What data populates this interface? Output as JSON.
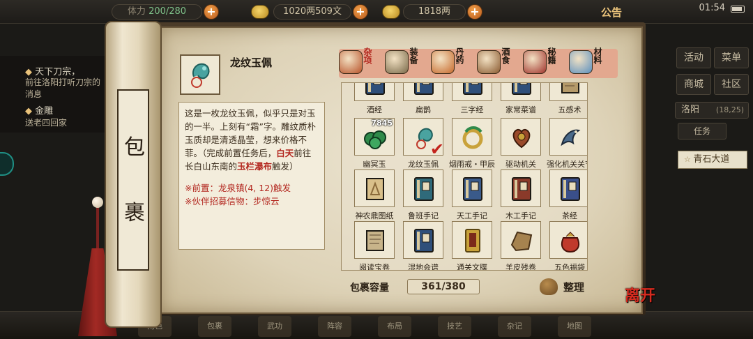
{
  "topbar": {
    "stamina_label": "体力",
    "stamina_value": "200/280",
    "money": "1020两509文",
    "ingot": "1818两",
    "notice": "公告",
    "clock": "01:54"
  },
  "quests": [
    {
      "title": "天下刀宗，",
      "desc": "前往洛阳打听刀宗的消息"
    },
    {
      "title": "金雕",
      "desc": "送老四回家"
    }
  ],
  "right_panel": {
    "buttons": [
      "活动",
      "菜单",
      "商城",
      "社区"
    ],
    "location": "洛阳",
    "coord": "(18,25)",
    "sub_tab": "任务",
    "place": "青石大道"
  },
  "scroll": {
    "title_chars": [
      "包",
      "裹"
    ]
  },
  "detail": {
    "name": "龙纹玉佩",
    "desc_parts": [
      {
        "text": "这是一枚龙纹玉佩，似乎只是对玉的一半。上刻有“霜”字。雕纹质朴玉质却是清透晶莹，想来价格不菲。（完成前置任务后，",
        "hl": false
      },
      {
        "text": "白天",
        "hl": true
      },
      {
        "text": "前往长白山东南的",
        "hl": false
      },
      {
        "text": "玉栏瀑布",
        "hl": true
      },
      {
        "text": "触发）",
        "hl": false
      }
    ],
    "requirements": [
      "※前置：龙泉镇(4, 12)触发",
      "※伙伴招募信物：步惊云"
    ]
  },
  "tabs": [
    {
      "label": "杂项",
      "active": true,
      "color": "#b8532a"
    },
    {
      "label": "装备",
      "active": false,
      "color": "#7a6a4a"
    },
    {
      "label": "丹药",
      "active": false,
      "color": "#c76a2c"
    },
    {
      "label": "酒食",
      "active": false,
      "color": "#8a5a30"
    },
    {
      "label": "秘籍",
      "active": false,
      "color": "#a0332c"
    },
    {
      "label": "材料",
      "active": false,
      "color": "#5a8fbf"
    }
  ],
  "grid_rows": [
    {
      "partial_top": true,
      "items": [
        {
          "name": "酒经",
          "icon": "book-icon",
          "color": "#2f4f7a"
        },
        {
          "name": "扁鹊",
          "icon": "book-icon",
          "color": "#2f4f7a"
        },
        {
          "name": "三字经",
          "icon": "book-icon",
          "color": "#2f4f7a"
        },
        {
          "name": "家常菜谱",
          "icon": "book-icon",
          "color": "#2f4f7a"
        },
        {
          "name": "五感术",
          "icon": "scroll-icon",
          "color": "#b59a6a"
        }
      ]
    },
    {
      "partial_top": false,
      "items": [
        {
          "name": "幽冥玉",
          "icon": "jade-icon",
          "color": "#2f8a4a",
          "count": "7845"
        },
        {
          "name": "龙纹玉佩",
          "icon": "pendant-icon",
          "color": "#4aa3a0",
          "checked": true
        },
        {
          "name": "烟雨戒・甲辰",
          "icon": "ring-icon",
          "color": "#c9a23a"
        },
        {
          "name": "驱动机关",
          "icon": "mechanism-icon",
          "color": "#9a4a2a"
        },
        {
          "name": "强化机关关节",
          "icon": "dragon-icon",
          "color": "#4a6a8a"
        }
      ]
    },
    {
      "partial_top": false,
      "items": [
        {
          "name": "神农鼎图纸",
          "icon": "blueprint-icon",
          "color": "#8a6a3a"
        },
        {
          "name": "鲁班手记",
          "icon": "book-icon",
          "color": "#2f6a7a"
        },
        {
          "name": "天工手记",
          "icon": "book-icon",
          "color": "#3a5a8a"
        },
        {
          "name": "木工手记",
          "icon": "book-icon",
          "color": "#8a3a2a"
        },
        {
          "name": "茶经",
          "icon": "book-icon",
          "color": "#3a4f8a"
        }
      ]
    },
    {
      "partial_top": false,
      "items": [
        {
          "name": "阅读宝卷",
          "icon": "scroll-icon",
          "color": "#c8b48a"
        },
        {
          "name": "湿地会谱",
          "icon": "book-icon",
          "color": "#2f4f7a"
        },
        {
          "name": "通关文牒",
          "icon": "token-icon",
          "color": "#c9a23a"
        },
        {
          "name": "羊皮残卷",
          "icon": "leather-icon",
          "color": "#a6834f"
        },
        {
          "name": "五色福袋",
          "icon": "pouch-icon",
          "color": "#c0392b"
        }
      ]
    }
  ],
  "capacity": {
    "label": "包裹容量",
    "value": "361/380"
  },
  "sort_label": "整理",
  "close_label": "离开",
  "bottom_slots": [
    "角色",
    "包裹",
    "武功",
    "阵容",
    "布局",
    "技艺",
    "杂记",
    "地图"
  ]
}
